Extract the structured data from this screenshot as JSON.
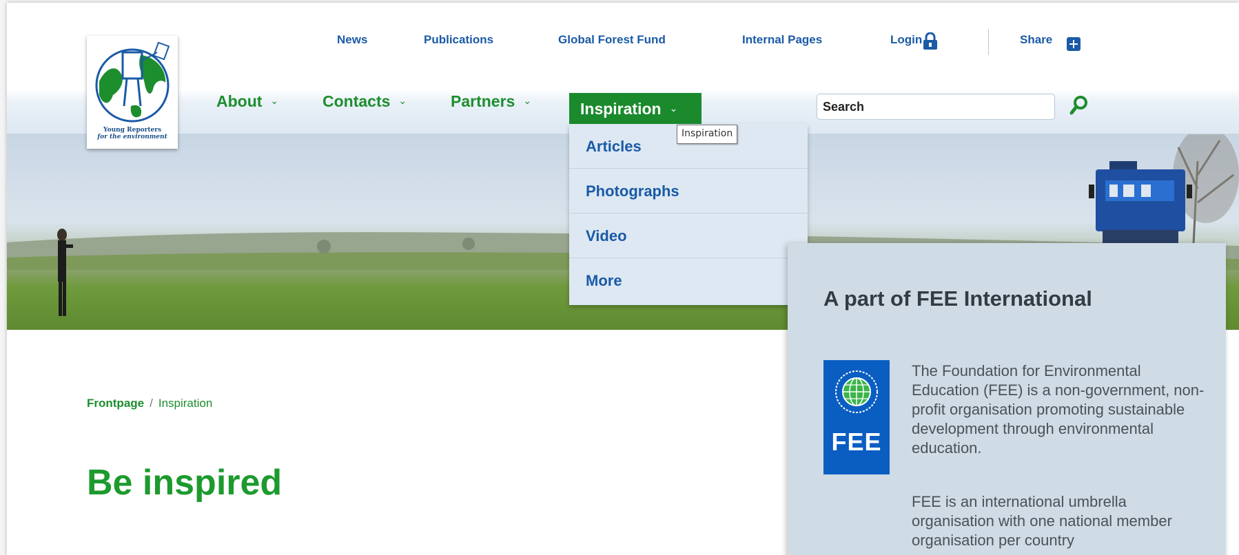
{
  "logo": {
    "line1": "Young Reporters",
    "line2": "for the environment"
  },
  "top_nav": {
    "news": "News",
    "publications": "Publications",
    "global_forest_fund": "Global Forest Fund",
    "internal_pages": "Internal Pages",
    "login": "Login",
    "share": "Share"
  },
  "main_nav": {
    "about": "About",
    "contacts": "Contacts",
    "partners": "Partners",
    "inspiration": "Inspiration"
  },
  "search": {
    "placeholder": "Search"
  },
  "dropdown": {
    "items": [
      "Articles",
      "Photographs",
      "Video",
      "More"
    ]
  },
  "tooltip": "Inspiration",
  "breadcrumb": {
    "home": "Frontpage",
    "separator": "/",
    "current": "Inspiration"
  },
  "page_title": "Be inspired",
  "fee_panel": {
    "heading": "A part of FEE International",
    "logo_text": "FEE",
    "paragraph1": "The Foundation for Environmental Education (FEE) is a non-government, non-profit organisation promoting sustainable development through environmental education.",
    "paragraph2": "FEE is an international umbrella organisation with one national member organisation per country"
  },
  "colors": {
    "brand_green": "#1d8e2e",
    "link_blue": "#1a5aa6",
    "dropdown_bg": "#dde8f2",
    "panel_bg": "#cfdbe5",
    "fee_blue": "#0a5ec2"
  }
}
